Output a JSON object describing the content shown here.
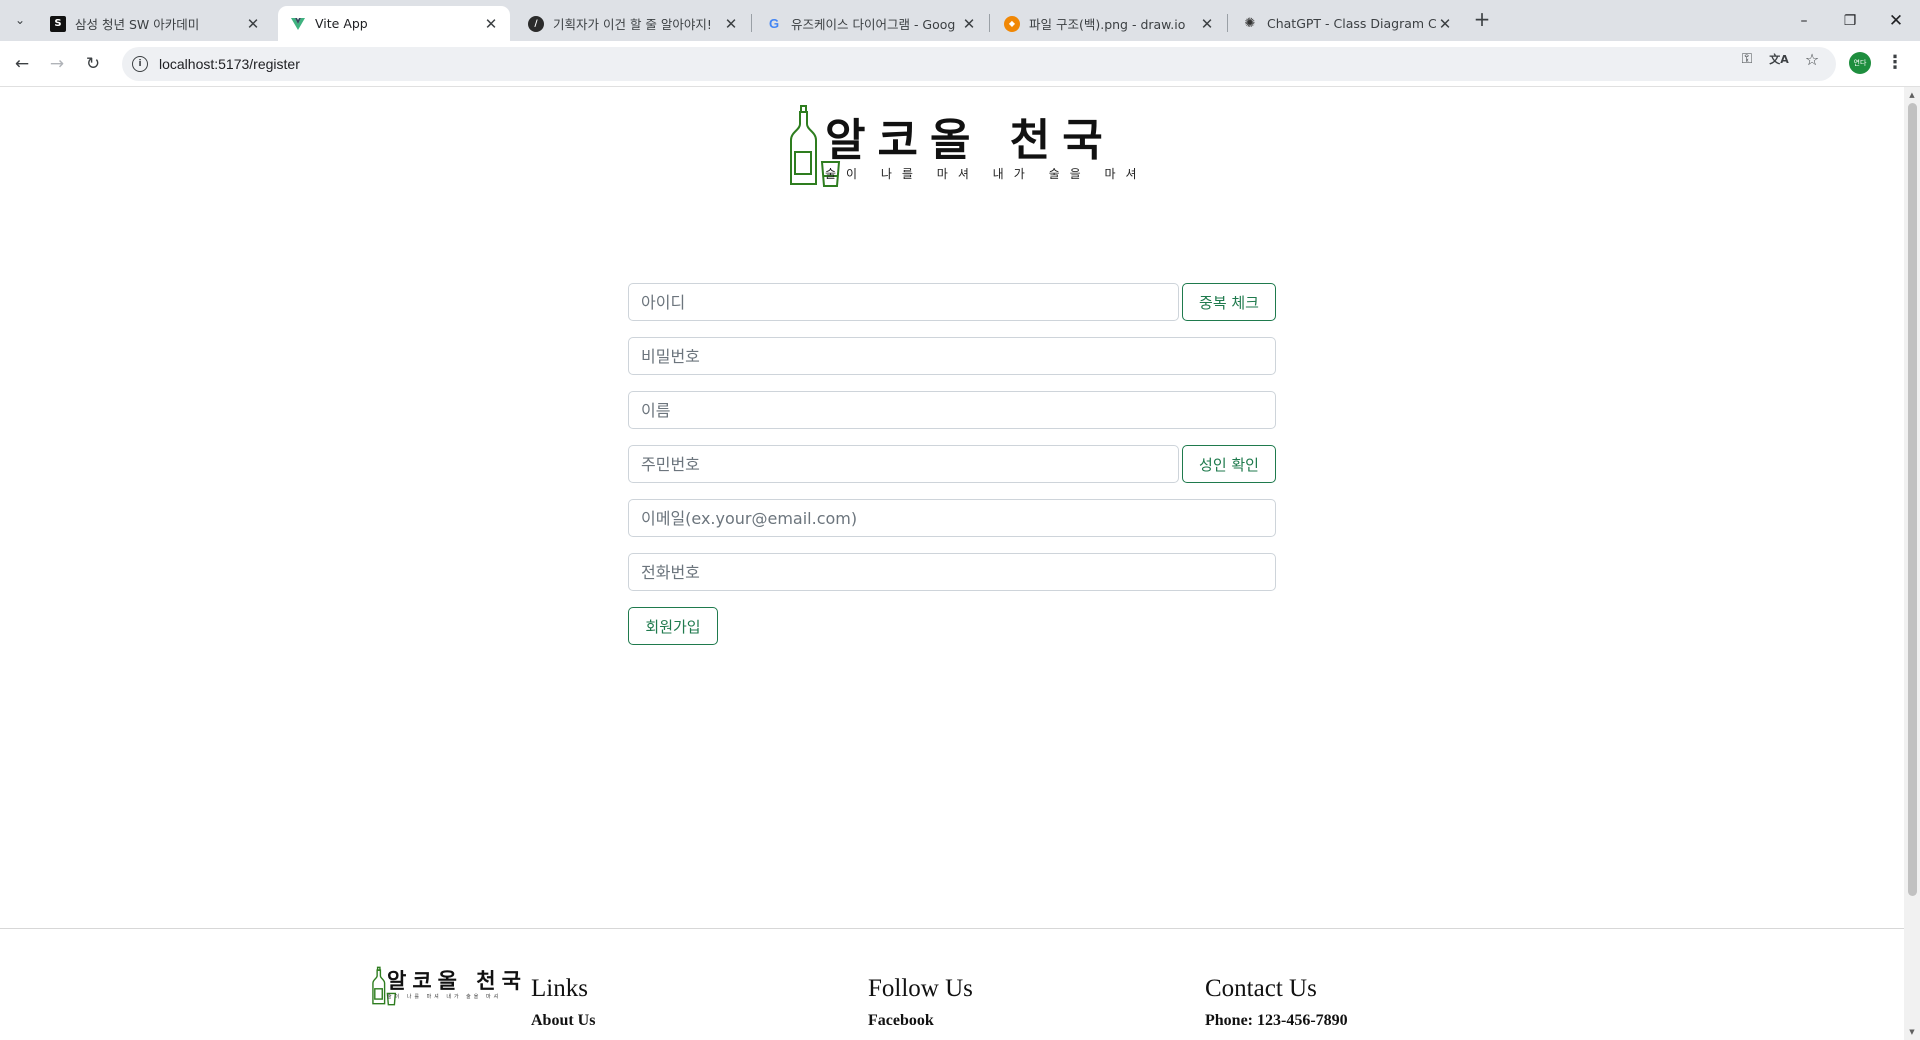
{
  "browser": {
    "tabs": [
      {
        "title": "삼성 청년 SW 아카데미",
        "icon": "ssafy-icon",
        "active": false
      },
      {
        "title": "Vite App",
        "icon": "vite-icon",
        "active": true
      },
      {
        "title": "기획자가 이건 할 줄 알아야지!",
        "icon": "article-icon",
        "active": false
      },
      {
        "title": "유즈케이스 다이어그램 - Goog",
        "icon": "google-icon",
        "active": false
      },
      {
        "title": "파일 구조(백).png - draw.io",
        "icon": "drawio-icon",
        "active": false
      },
      {
        "title": "ChatGPT - Class Diagram Crea",
        "icon": "chatgpt-icon",
        "active": false
      }
    ],
    "url": "localhost:5173/register",
    "profile_initials": "연다"
  },
  "brand": {
    "title": "알코올 천국",
    "slogan": "술이 나를 마셔 내가 술을 마셔",
    "color": "#2e7d1f"
  },
  "form": {
    "username_placeholder": "아이디",
    "dup_check_label": "중복 체크",
    "password_placeholder": "비밀번호",
    "name_placeholder": "이름",
    "rrn_placeholder": "주민번호",
    "adult_check_label": "성인 확인",
    "email_placeholder": "이메일(ex.your@email.com)",
    "phone_placeholder": "전화번호",
    "submit_label": "회원가입",
    "accent_color": "#1f7a4d"
  },
  "footer": {
    "brand_title": "알코올 천국",
    "brand_slogan": "술이 나를 마셔 내가 술을 마셔",
    "links": {
      "heading": "Links",
      "first_item": "About Us"
    },
    "follow": {
      "heading": "Follow Us",
      "first_item": "Facebook"
    },
    "contact": {
      "heading": "Contact Us",
      "first_item": "Phone: 123-456-7890"
    }
  }
}
